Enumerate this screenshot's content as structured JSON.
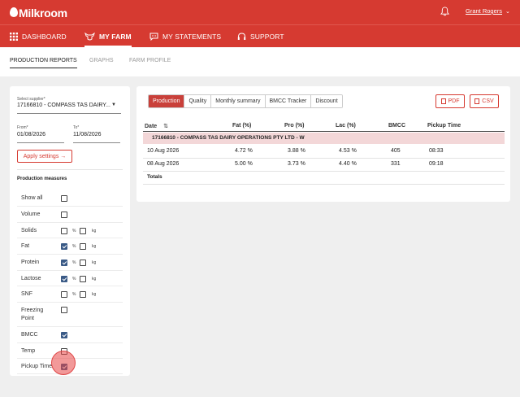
{
  "app": {
    "logo_text": "Milkroom",
    "user_name": "Grant Rogers"
  },
  "nav": {
    "dashboard": "DASHBOARD",
    "my_farm": "MY FARM",
    "my_statements": "MY STATEMENTS",
    "support": "SUPPORT"
  },
  "subnav": {
    "production_reports": "PRODUCTION REPORTS",
    "graphs": "GRAPHS",
    "farm_profile": "FARM PROFILE"
  },
  "filters": {
    "supplier_label": "Select supplier*",
    "supplier_value": "17166810 - COMPASS TAS DAIRY...",
    "from_label": "From*",
    "from_value": "01/08/2026",
    "to_label": "To*",
    "to_value": "11/08/2026",
    "apply_label": "Apply settings →"
  },
  "measures": {
    "title": "Production measures",
    "unit_percent": "%",
    "unit_kg": "kg",
    "items": [
      {
        "label": "Show all"
      },
      {
        "label": "Volume"
      },
      {
        "label": "Solids"
      },
      {
        "label": "Fat"
      },
      {
        "label": "Protein"
      },
      {
        "label": "Lactose"
      },
      {
        "label": "SNF"
      },
      {
        "label": "Freezing Point"
      },
      {
        "label": "BMCC"
      },
      {
        "label": "Temp"
      },
      {
        "label": "Pickup Time"
      }
    ]
  },
  "report": {
    "tabs": [
      "Production",
      "Quality",
      "Monthly summary",
      "BMCC Tracker",
      "Discount"
    ],
    "pdf_label": "PDF",
    "csv_label": "CSV",
    "columns": [
      "Date",
      "Fat (%)",
      "Pro (%)",
      "Lac (%)",
      "BMCC",
      "Pickup Time"
    ],
    "group_title": "17166810 - COMPASS TAS DAIRY OPERATIONS PTY LTD - W",
    "rows": [
      {
        "date": "10 Aug 2026",
        "fat": "4.72 %",
        "pro": "3.88 %",
        "lac": "4.53 %",
        "bmcc": "405",
        "pickup": "08:33"
      },
      {
        "date": "08 Aug 2026",
        "fat": "5.00 %",
        "pro": "3.73 %",
        "lac": "4.40 %",
        "bmcc": "331",
        "pickup": "09:18"
      }
    ],
    "totals_label": "Totals"
  },
  "colors": {
    "brand_red": "#d63a31",
    "checkbox_blue": "#3a5a86",
    "group_row_pink": "#f3d7d8"
  }
}
